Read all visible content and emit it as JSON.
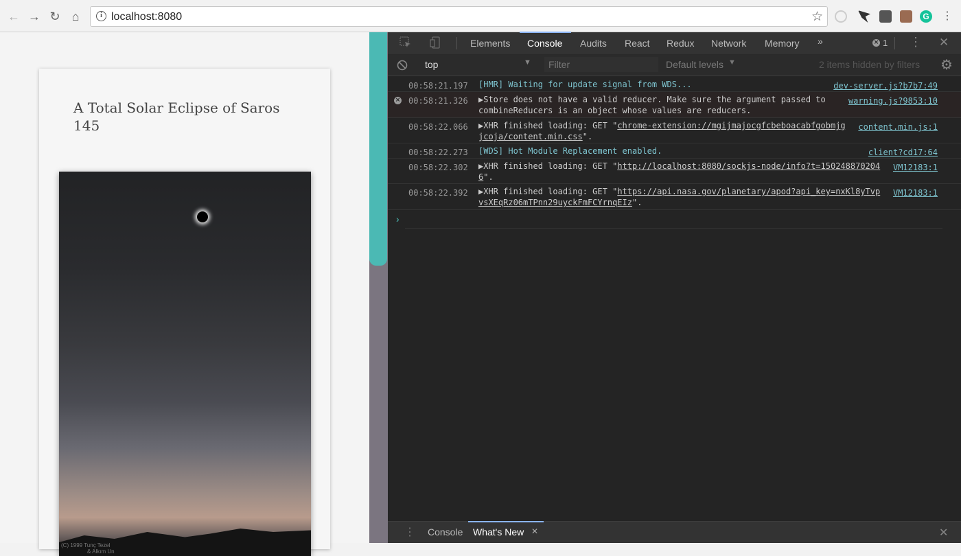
{
  "browser": {
    "url": "localhost:8080",
    "info_icon": "info-icon",
    "icons": [
      "back-arrow-icon",
      "forward-arrow-icon",
      "reload-icon",
      "home-icon",
      "star-icon"
    ]
  },
  "article": {
    "title": "A Total Solar Eclipse of Saros 145",
    "credit_line1": "(C) 1999",
    "credit_name": "Tunç Tezel",
    "credit_line2": "& Alkım Un"
  },
  "devtools": {
    "tabs": [
      "Elements",
      "Console",
      "Audits",
      "React",
      "Redux",
      "Network",
      "Memory"
    ],
    "more_tabs": "»",
    "error_count": "1",
    "context": "top",
    "filter_placeholder": "Filter",
    "levels": "Default levels",
    "hidden_note": "2 items hidden by filters",
    "drawer_tabs": [
      "Console",
      "What's New"
    ],
    "colors": {
      "accent": "#4bb9b4",
      "link": "#7ec4cf",
      "bg": "#242424"
    },
    "log": [
      {
        "time": "00:58:21.197",
        "text": "[HMR] Waiting for update signal from WDS...",
        "source": "dev-server.js?b7b7:49"
      },
      {
        "time": "00:58:21.326",
        "text": "Store does not have a valid reducer. Make sure the argument passed to combineReducers is an object whose values are reducers.",
        "source": "warning.js?9853:10"
      },
      {
        "time": "00:58:22.066",
        "prefix": "XHR finished loading: GET \"",
        "link": "chrome-extension://mgijmajocgfcbeboacabfgobmjgjcoja/content.min.css",
        "suffix": "\".",
        "source": "content.min.js:1"
      },
      {
        "time": "00:58:22.273",
        "text": "[WDS] Hot Module Replacement enabled.",
        "source": "client?cd17:64"
      },
      {
        "time": "00:58:22.302",
        "prefix": "XHR finished loading: GET \"",
        "link": "http://localhost:8080/sockjs-node/info?t=1502488702046",
        "suffix": "\".",
        "source": "VM12183:1"
      },
      {
        "time": "00:58:22.392",
        "prefix": "XHR finished loading: GET \"",
        "link": "https://api.nasa.gov/planetary/apod?api_key=nxKl8yTvpvsXEqRz06mTPnn29uyckFmFCYrnqEIz",
        "suffix": "\".",
        "source": "VM12183:1"
      }
    ]
  }
}
